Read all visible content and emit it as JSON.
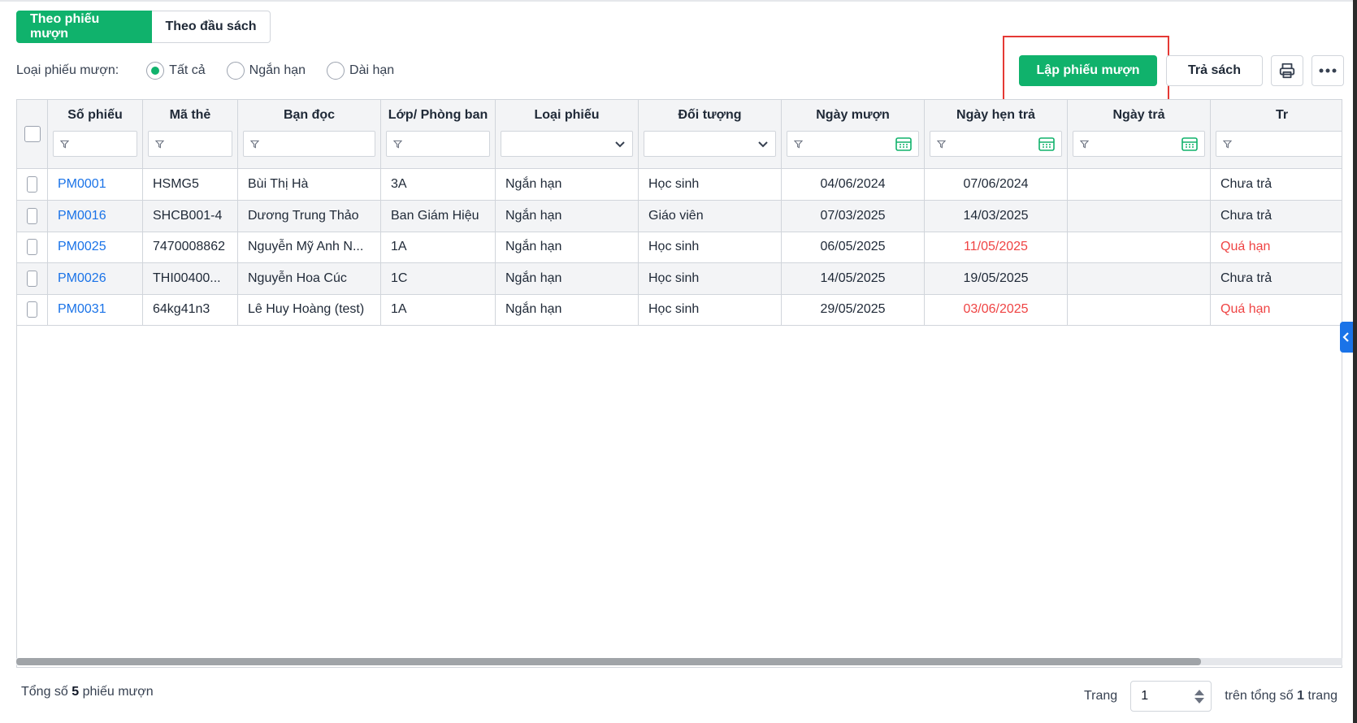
{
  "tabs": [
    {
      "label": "Theo phiếu mượn",
      "active": true
    },
    {
      "label": "Theo đầu sách",
      "active": false
    }
  ],
  "filter": {
    "label": "Loại phiếu mượn:",
    "options": [
      {
        "label": "Tất cả",
        "checked": true
      },
      {
        "label": "Ngắn hạn",
        "checked": false
      },
      {
        "label": "Dài hạn",
        "checked": false
      }
    ]
  },
  "actions": {
    "create_label": "Lập phiếu mượn",
    "return_label": "Trả sách",
    "print_icon": "printer-icon",
    "more_icon": "more-horizontal-icon"
  },
  "table": {
    "columns": [
      {
        "label": "Số phiếu",
        "filter": "text"
      },
      {
        "label": "Mã thẻ",
        "filter": "text"
      },
      {
        "label": "Bạn đọc",
        "filter": "text"
      },
      {
        "label": "Lớp/ Phòng ban",
        "filter": "text"
      },
      {
        "label": "Loại phiếu",
        "filter": "select"
      },
      {
        "label": "Đối tượng",
        "filter": "select"
      },
      {
        "label": "Ngày mượn",
        "filter": "date"
      },
      {
        "label": "Ngày hẹn trả",
        "filter": "date"
      },
      {
        "label": "Ngày trả",
        "filter": "date"
      },
      {
        "label": "Tr",
        "filter": "text"
      }
    ],
    "rows": [
      {
        "so_phieu": "PM0001",
        "ma_the": "HSMG5",
        "ban_doc": "Bùi Thị Hà",
        "lop": "3A",
        "loai": "Ngắn hạn",
        "doi_tuong": "Học sinh",
        "ngay_muon": "04/06/2024",
        "ngay_hen_tra": "07/06/2024",
        "ngay_tra": "",
        "trang_thai": "Chưa trả",
        "overdue": false
      },
      {
        "so_phieu": "PM0016",
        "ma_the": "SHCB001-4",
        "ban_doc": "Dương Trung Thảo",
        "lop": "Ban Giám Hiệu",
        "loai": "Ngắn hạn",
        "doi_tuong": "Giáo viên",
        "ngay_muon": "07/03/2025",
        "ngay_hen_tra": "14/03/2025",
        "ngay_tra": "",
        "trang_thai": "Chưa trả",
        "overdue": false
      },
      {
        "so_phieu": "PM0025",
        "ma_the": "7470008862",
        "ban_doc": "Nguyễn Mỹ Anh N...",
        "lop": "1A",
        "loai": "Ngắn hạn",
        "doi_tuong": "Học sinh",
        "ngay_muon": "06/05/2025",
        "ngay_hen_tra": "11/05/2025",
        "ngay_tra": "",
        "trang_thai": "Quá hạn",
        "overdue": true
      },
      {
        "so_phieu": "PM0026",
        "ma_the": "THI00400...",
        "ban_doc": "Nguyễn Hoa Cúc",
        "lop": "1C",
        "loai": "Ngắn hạn",
        "doi_tuong": "Học sinh",
        "ngay_muon": "14/05/2025",
        "ngay_hen_tra": "19/05/2025",
        "ngay_tra": "",
        "trang_thai": "Chưa trả",
        "overdue": false
      },
      {
        "so_phieu": "PM0031",
        "ma_the": "64kg41n3",
        "ban_doc": "Lê Huy Hoàng (test)",
        "lop": "1A",
        "loai": "Ngắn hạn",
        "doi_tuong": "Học sinh",
        "ngay_muon": "29/05/2025",
        "ngay_hen_tra": "03/06/2025",
        "ngay_tra": "",
        "trang_thai": "Quá hạn",
        "overdue": true
      }
    ]
  },
  "footer": {
    "total_prefix": "Tổng số",
    "total_count": "5",
    "total_suffix": "phiếu mượn",
    "page_label": "Trang",
    "page_value": "1",
    "of_total_prefix": "trên tổng số",
    "total_pages": "1",
    "of_total_suffix": "trang"
  },
  "colors": {
    "primary": "#10b26c",
    "link": "#1a73e8",
    "overdue": "#ef4444",
    "highlight": "#e53935"
  }
}
